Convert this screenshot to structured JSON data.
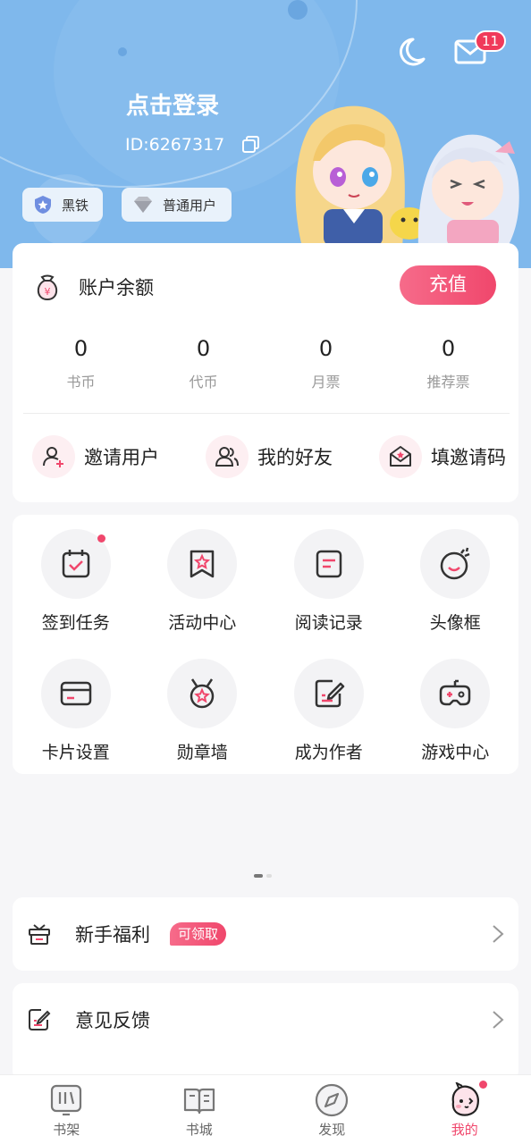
{
  "header": {
    "login_text": "点击登录",
    "user_id": "ID:6267317",
    "mail_badge": "11",
    "chips": [
      {
        "label": "黑铁"
      },
      {
        "label": "普通用户"
      }
    ]
  },
  "balance": {
    "label": "账户余额",
    "recharge_label": "充值",
    "stats": [
      {
        "value": "0",
        "label": "书币"
      },
      {
        "value": "0",
        "label": "代币"
      },
      {
        "value": "0",
        "label": "月票"
      },
      {
        "value": "0",
        "label": "推荐票"
      }
    ],
    "actions": [
      {
        "label": "邀请用户",
        "icon": "invite-user-icon"
      },
      {
        "label": "我的好友",
        "icon": "friends-icon"
      },
      {
        "label": "填邀请码",
        "icon": "invite-code-icon"
      }
    ]
  },
  "grid": [
    {
      "label": "签到任务",
      "icon": "calendar-check-icon"
    },
    {
      "label": "活动中心",
      "icon": "star-bookmark-icon"
    },
    {
      "label": "阅读记录",
      "icon": "document-icon"
    },
    {
      "label": "头像框",
      "icon": "avatar-frame-icon"
    },
    {
      "label": "卡片设置",
      "icon": "card-icon"
    },
    {
      "label": "勋章墙",
      "icon": "medal-icon"
    },
    {
      "label": "成为作者",
      "icon": "edit-icon"
    },
    {
      "label": "游戏中心",
      "icon": "gamepad-icon"
    }
  ],
  "rows": [
    {
      "label": "新手福利",
      "tag": "可领取",
      "icon": "gift-icon"
    },
    {
      "label": "意见反馈",
      "icon": "feedback-icon"
    }
  ],
  "nav": [
    {
      "label": "书架",
      "icon": "bookshelf-icon"
    },
    {
      "label": "书城",
      "icon": "book-store-icon"
    },
    {
      "label": "发现",
      "icon": "compass-icon"
    },
    {
      "label": "我的",
      "icon": "profile-mascot-icon"
    }
  ],
  "colors": {
    "header_bg": "#7fb8ec",
    "accent": "#f0476c",
    "page_bg": "#f6f6f8"
  }
}
